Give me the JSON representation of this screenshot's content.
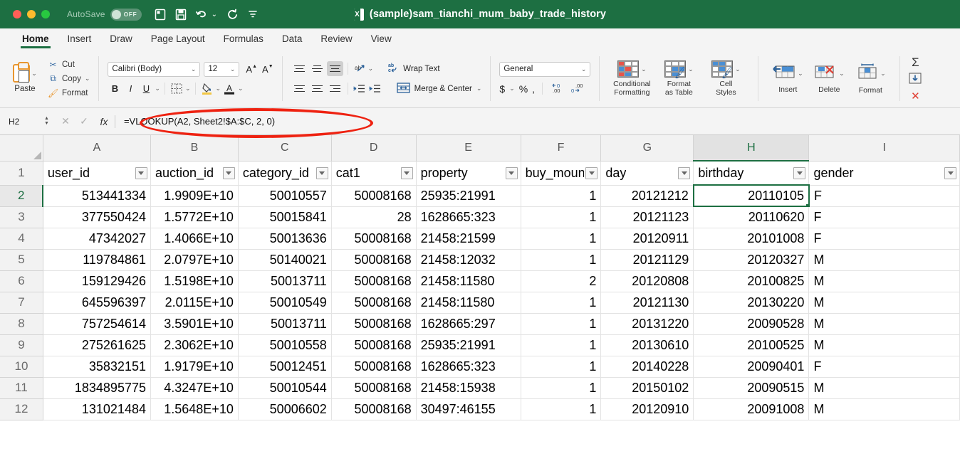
{
  "window": {
    "title": "(sample)sam_tianchi_mum_baby_trade_history",
    "autosave_label": "AutoSave",
    "autosave_state": "OFF",
    "accent_color": "#1d6f42",
    "annotation_color": "#ee2211"
  },
  "tabs": [
    {
      "label": "Home",
      "active": true
    },
    {
      "label": "Insert",
      "active": false
    },
    {
      "label": "Draw",
      "active": false
    },
    {
      "label": "Page Layout",
      "active": false
    },
    {
      "label": "Formulas",
      "active": false
    },
    {
      "label": "Data",
      "active": false
    },
    {
      "label": "Review",
      "active": false
    },
    {
      "label": "View",
      "active": false
    }
  ],
  "ribbon": {
    "clipboard": {
      "paste_label": "Paste",
      "cut_label": "Cut",
      "copy_label": "Copy",
      "format_label": "Format"
    },
    "font": {
      "family_value": "Calibri (Body)",
      "size_value": "12",
      "bold": "B",
      "italic": "I",
      "underline": "U",
      "grow_font": "A",
      "shrink_font": "A"
    },
    "alignment": {
      "wrap_text_label": "Wrap Text",
      "merge_center_label": "Merge & Center"
    },
    "number": {
      "format_value": "General",
      "currency": "$",
      "percent": "%",
      "comma": ",",
      "decrease_decimal": ".00",
      "increase_decimal": ".00"
    },
    "styles": {
      "conditional_formatting_label": "Conditional\nFormatting",
      "conditional_formatting_line1": "Conditional",
      "conditional_formatting_line2": "Formatting",
      "format_as_table_line1": "Format",
      "format_as_table_line2": "as Table",
      "cell_styles_line1": "Cell",
      "cell_styles_line2": "Styles"
    },
    "cells": {
      "insert_label": "Insert",
      "delete_label": "Delete",
      "format_label": "Format"
    },
    "editing": {
      "autosum": "Σ",
      "fill": "↓",
      "clear": "✕"
    }
  },
  "formula_bar": {
    "name_box": "H2",
    "cancel": "✕",
    "confirm": "✓",
    "fx": "fx",
    "formula": "=VLOOKUP(A2, Sheet2!$A:$C, 2, 0)"
  },
  "sheet": {
    "selected_cell": "H2",
    "selected_column": "H",
    "column_letters": [
      "A",
      "B",
      "C",
      "D",
      "E",
      "F",
      "G",
      "H",
      "I"
    ],
    "row_numbers": [
      "1",
      "2",
      "3",
      "4",
      "5",
      "6",
      "7",
      "8",
      "9",
      "10",
      "11",
      "12"
    ],
    "headers": [
      "user_id",
      "auction_id",
      "category_id",
      "cat1",
      "property",
      "buy_mount",
      "day",
      "birthday",
      "gender"
    ],
    "rows": [
      [
        "513441334",
        "1.9909E+10",
        "50010557",
        "50008168",
        "25935:21991",
        "1",
        "20121212",
        "20110105",
        "F"
      ],
      [
        "377550424",
        "1.5772E+10",
        "50015841",
        "28",
        "1628665:323",
        "1",
        "20121123",
        "20110620",
        "F"
      ],
      [
        "47342027",
        "1.4066E+10",
        "50013636",
        "50008168",
        "21458:21599",
        "1",
        "20120911",
        "20101008",
        "F"
      ],
      [
        "119784861",
        "2.0797E+10",
        "50140021",
        "50008168",
        "21458:12032",
        "1",
        "20121129",
        "20120327",
        "M"
      ],
      [
        "159129426",
        "1.5198E+10",
        "50013711",
        "50008168",
        "21458:11580",
        "2",
        "20120808",
        "20100825",
        "M"
      ],
      [
        "645596397",
        "2.0115E+10",
        "50010549",
        "50008168",
        "21458:11580",
        "1",
        "20121130",
        "20130220",
        "M"
      ],
      [
        "757254614",
        "3.5901E+10",
        "50013711",
        "50008168",
        "1628665:297",
        "1",
        "20131220",
        "20090528",
        "M"
      ],
      [
        "275261625",
        "2.3062E+10",
        "50010558",
        "50008168",
        "25935:21991",
        "1",
        "20130610",
        "20100525",
        "M"
      ],
      [
        "35832151",
        "1.9179E+10",
        "50012451",
        "50008168",
        "1628665:323",
        "1",
        "20140228",
        "20090401",
        "F"
      ],
      [
        "1834895775",
        "4.3247E+10",
        "50010544",
        "50008168",
        "21458:15938",
        "1",
        "20150102",
        "20090515",
        "M"
      ],
      [
        "131021484",
        "1.5648E+10",
        "50006602",
        "50008168",
        "30497:46155",
        "1",
        "20120910",
        "20091008",
        "M"
      ]
    ],
    "column_alignments": [
      "num",
      "num",
      "num",
      "num",
      "txt",
      "num",
      "num",
      "num",
      "txt"
    ]
  }
}
